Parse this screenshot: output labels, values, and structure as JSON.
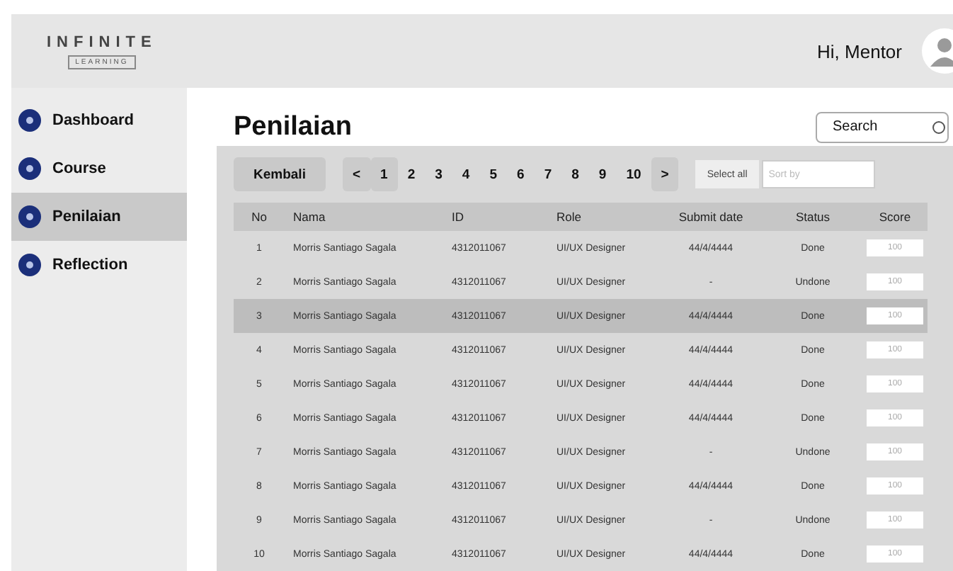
{
  "logo": {
    "title": "INFINITE",
    "subtitle": "LEARNING"
  },
  "header": {
    "greeting": "Hi, Mentor"
  },
  "sidebar": {
    "items": [
      {
        "label": "Dashboard",
        "selected": false
      },
      {
        "label": "Course",
        "selected": false
      },
      {
        "label": "Penilaian",
        "selected": true
      },
      {
        "label": "Reflection",
        "selected": false
      }
    ]
  },
  "page": {
    "title": "Penilaian",
    "search": {
      "placeholder": "Search"
    }
  },
  "toolbar": {
    "back": "Kembali",
    "prev": "<",
    "next": ">",
    "pages": [
      {
        "label": "1",
        "selected": true
      },
      {
        "label": "2",
        "selected": false
      },
      {
        "label": "3",
        "selected": false
      },
      {
        "label": "4",
        "selected": false
      },
      {
        "label": "5",
        "selected": false
      },
      {
        "label": "6",
        "selected": false
      },
      {
        "label": "7",
        "selected": false
      },
      {
        "label": "8",
        "selected": false
      },
      {
        "label": "9",
        "selected": false
      },
      {
        "label": "10",
        "selected": false
      }
    ],
    "select_all": "Select all",
    "sort": {
      "placeholder": "Sort by"
    }
  },
  "table": {
    "columns": [
      "No",
      "Nama",
      "ID",
      "Role",
      "Submit date",
      "Status",
      "Score"
    ],
    "rows": [
      {
        "no": "1",
        "name": "Morris Santiago Sagala",
        "id": "4312011067",
        "role": "UI/UX Designer",
        "date": "44/4/4444",
        "status": "Done",
        "score": "100",
        "selected": false
      },
      {
        "no": "2",
        "name": "Morris Santiago Sagala",
        "id": "4312011067",
        "role": "UI/UX Designer",
        "date": "-",
        "status": "Undone",
        "score": "100",
        "selected": false
      },
      {
        "no": "3",
        "name": "Morris Santiago Sagala",
        "id": "4312011067",
        "role": "UI/UX Designer",
        "date": "44/4/4444",
        "status": "Done",
        "score": "100",
        "selected": true
      },
      {
        "no": "4",
        "name": "Morris Santiago Sagala",
        "id": "4312011067",
        "role": "UI/UX Designer",
        "date": "44/4/4444",
        "status": "Done",
        "score": "100",
        "selected": false
      },
      {
        "no": "5",
        "name": "Morris Santiago Sagala",
        "id": "4312011067",
        "role": "UI/UX Designer",
        "date": "44/4/4444",
        "status": "Done",
        "score": "100",
        "selected": false
      },
      {
        "no": "6",
        "name": "Morris Santiago Sagala",
        "id": "4312011067",
        "role": "UI/UX Designer",
        "date": "44/4/4444",
        "status": "Done",
        "score": "100",
        "selected": false
      },
      {
        "no": "7",
        "name": "Morris Santiago Sagala",
        "id": "4312011067",
        "role": "UI/UX Designer",
        "date": "-",
        "status": "Undone",
        "score": "100",
        "selected": false
      },
      {
        "no": "8",
        "name": "Morris Santiago Sagala",
        "id": "4312011067",
        "role": "UI/UX Designer",
        "date": "44/4/4444",
        "status": "Done",
        "score": "100",
        "selected": false
      },
      {
        "no": "9",
        "name": "Morris Santiago Sagala",
        "id": "4312011067",
        "role": "UI/UX Designer",
        "date": "-",
        "status": "Undone",
        "score": "100",
        "selected": false
      },
      {
        "no": "10",
        "name": "Morris Santiago Sagala",
        "id": "4312011067",
        "role": "UI/UX Designer",
        "date": "44/4/4444",
        "status": "Done",
        "score": "100",
        "selected": false
      }
    ]
  }
}
